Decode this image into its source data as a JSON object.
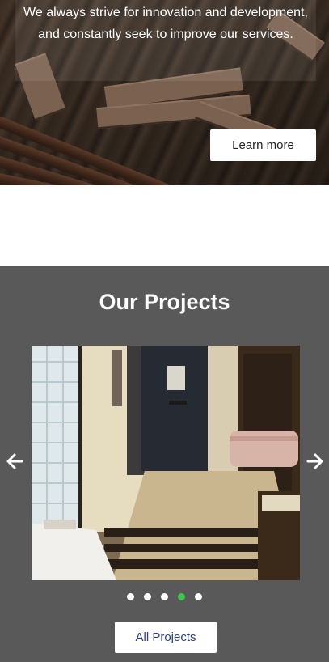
{
  "hero": {
    "text": "We always strive for innovation and development, and constantly seek to improve our services.",
    "button_label": "Learn more"
  },
  "projects": {
    "title": "Our Projects",
    "slide_image": "hotel-room-photo",
    "prev_icon": "arrow-left-icon",
    "next_icon": "arrow-right-icon",
    "dots_count": 5,
    "active_dot": 4,
    "button_label": "All Projects"
  },
  "colors": {
    "section_bg": "#595959",
    "active_dot": "#3cc84a",
    "link_blue": "#2b3f8a"
  }
}
